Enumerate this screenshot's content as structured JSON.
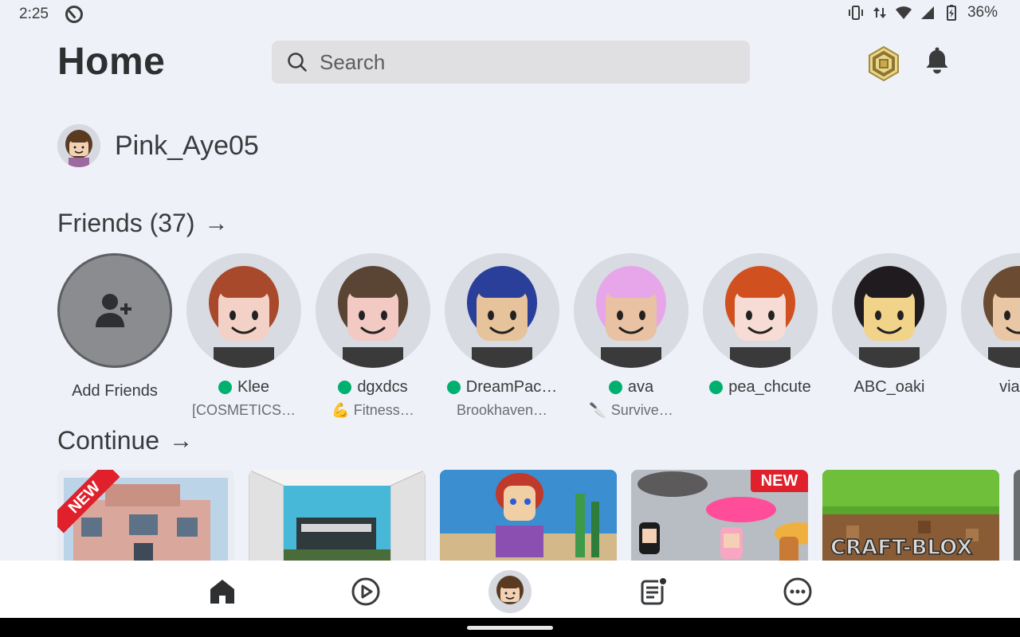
{
  "status_bar": {
    "time": "2:25",
    "battery": "36%"
  },
  "header": {
    "title": "Home",
    "search_placeholder": "Search"
  },
  "user": {
    "username": "Pink_Aye05"
  },
  "friends": {
    "heading": "Friends (37)",
    "add_label": "Add Friends",
    "items": [
      {
        "name": "Klee",
        "status": "[COSMETICS…",
        "online": true,
        "hair": "#a8492c",
        "skin": "#f4d1c6"
      },
      {
        "name": "dgxdcs",
        "status": "💪 Fitness…",
        "online": true,
        "hair": "#5a4434",
        "skin": "#f2c9c3"
      },
      {
        "name": "DreamPac…",
        "status": "Brookhaven…",
        "online": true,
        "hair": "#2a3f9a",
        "skin": "#e6c39a"
      },
      {
        "name": "ava",
        "status": "🔪 Survive…",
        "online": true,
        "hair": "#e7a6ea",
        "skin": "#e8c2a2"
      },
      {
        "name": "pea_chcute",
        "status": "",
        "online": true,
        "hair": "#d0501f",
        "skin": "#f6dcd4"
      },
      {
        "name": "ABC_oaki",
        "status": "",
        "online": false,
        "hair": "#1f1b1e",
        "skin": "#f2d38a"
      },
      {
        "name": "viana",
        "status": "",
        "online": false,
        "hair": "#6b4c32",
        "skin": "#e9c7a4"
      }
    ]
  },
  "continue": {
    "heading": "Continue",
    "new_label": "NEW"
  },
  "colors": {
    "background": "#eff1f8",
    "online": "#00b06f",
    "new_badge": "#e0202a"
  },
  "nav": {
    "items": [
      "home-icon",
      "play-icon",
      "avatar",
      "chat-icon",
      "more-icon"
    ]
  }
}
